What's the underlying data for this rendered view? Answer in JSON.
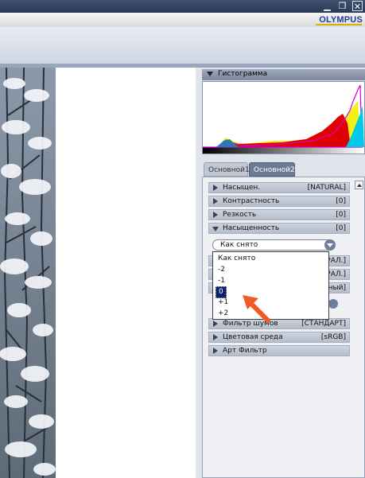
{
  "window": {
    "minimize": "▁",
    "restore": "❐",
    "close": "✕"
  },
  "brand": {
    "logo": "OLYMPUS"
  },
  "histogram": {
    "title": "Гистограмма"
  },
  "tabs": [
    {
      "label": "Основной1"
    },
    {
      "label": "Основной2"
    }
  ],
  "settings": {
    "rows": [
      {
        "label": "Насыщен.",
        "value": "[NATURAL]",
        "expanded": false
      },
      {
        "label": "Контрастность",
        "value": "[0]",
        "expanded": false
      },
      {
        "label": "Резкость",
        "value": "[0]",
        "expanded": false
      },
      {
        "label": "Насыщенность",
        "value": "[0]",
        "expanded": true
      },
      {
        "label": "Фильтр шумов",
        "value": "[СТАНДАРТ]",
        "expanded": false
      },
      {
        "label": "Цветовая среда",
        "value": "[sRGB]",
        "expanded": false
      },
      {
        "label": "Арт Фильтр",
        "value": "",
        "expanded": false
      }
    ],
    "hidden_rows_partial": [
      {
        "value": "РАЛ.]"
      },
      {
        "value": "РАЛ.]"
      },
      {
        "value": "нный]"
      }
    ],
    "saturation_select": {
      "current": "Как снято",
      "options": [
        "Как снято",
        "-2",
        "-1",
        "0",
        "+1",
        "+2"
      ],
      "highlighted": "0"
    }
  },
  "colors": {
    "accent": "#0a246a",
    "annotation_arrow": "#f15a22"
  }
}
